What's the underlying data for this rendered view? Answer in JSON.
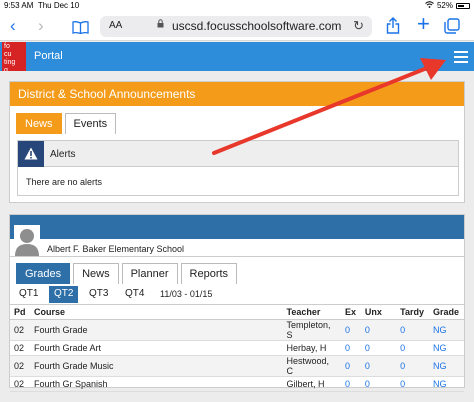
{
  "status_bar": {
    "time": "9:53 AM",
    "date": "Thu Dec 10",
    "battery": "52%"
  },
  "browser": {
    "aa": "AA",
    "url": "uscsd.focusschoolsoftware.com"
  },
  "header": {
    "logo_text": "fo\ncu\nting\ng",
    "portal": "Portal"
  },
  "announcements": {
    "title": "District & School Announcements",
    "tabs": [
      "News",
      "Events"
    ],
    "alerts_title": "Alerts",
    "alerts_body": "There are no alerts"
  },
  "student": {
    "school": "Albert F. Baker Elementary School",
    "tabs": [
      "Grades",
      "News",
      "Planner",
      "Reports"
    ],
    "quarters": [
      "QT1",
      "QT2",
      "QT3",
      "QT4"
    ],
    "dates": "11/03 - 01/15",
    "table": {
      "headers": [
        "Pd",
        "Course",
        "Teacher",
        "Ex",
        "Unx",
        "Tardy",
        "Grade"
      ],
      "rows": [
        [
          "02",
          "Fourth Grade",
          "Templeton, S",
          "0",
          "0",
          "0",
          "NG"
        ],
        [
          "02",
          "Fourth Grade Art",
          "Herbay, H",
          "0",
          "0",
          "0",
          "NG"
        ],
        [
          "02",
          "Fourth Grade Music",
          "Hestwood, C",
          "0",
          "0",
          "0",
          "NG"
        ],
        [
          "02",
          "Fourth Gr Spanish",
          "Gilbert, H",
          "0",
          "0",
          "0",
          "NG"
        ]
      ]
    }
  },
  "colors": {
    "accent_orange": "#f59b1a",
    "header_blue": "#2e8ddb",
    "tab_blue": "#2d6fa6",
    "arrow_red": "#e8372b"
  }
}
